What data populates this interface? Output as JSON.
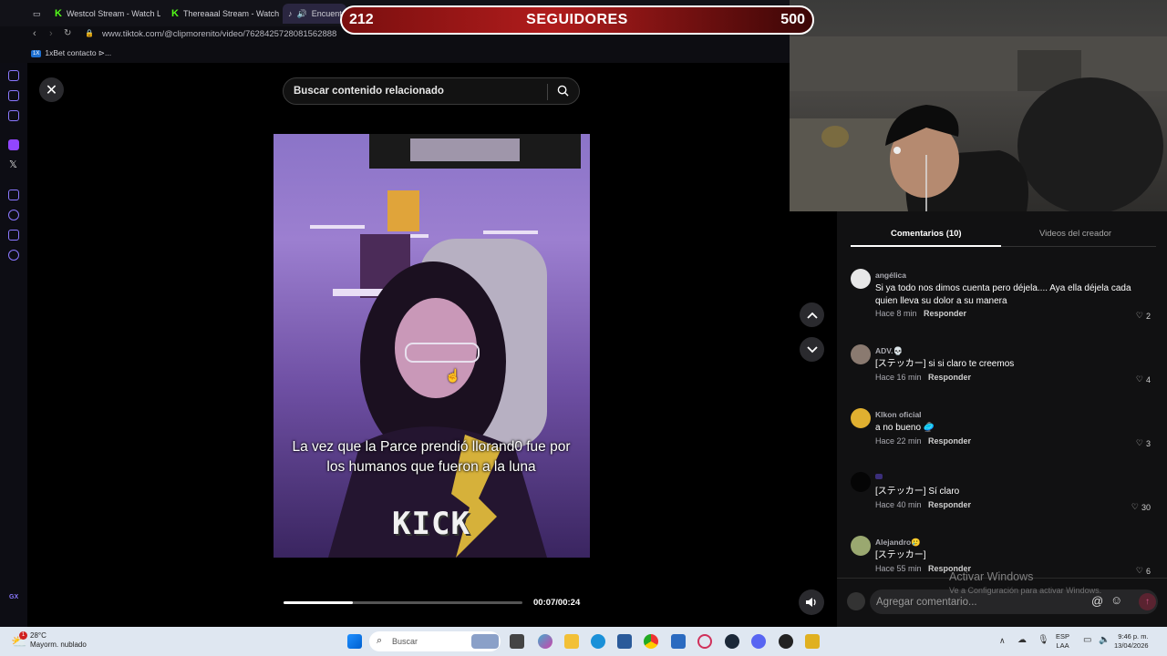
{
  "browser": {
    "tabs": [
      {
        "label": "Westcol Stream - Watch L"
      },
      {
        "label": "Thereaaal Stream - Watch"
      },
      {
        "label": "Encuent"
      }
    ],
    "url": "www.tiktok.com/@clipmorenito/video/7628425728081562888",
    "bookmark": "1xBet contacto ⊳..."
  },
  "overlay": {
    "count_left": "212",
    "label": "SEGUIDORES",
    "count_right": "500"
  },
  "tiktok": {
    "search_placeholder": "Buscar contenido relacionado",
    "caption": "La vez que la Parce prendió llorand0 fue por los humanos que fueron a la luna",
    "brand": "KICK",
    "time": "00:07/00:24",
    "progress": 0.29,
    "tabs": {
      "comments": "Comentarios (10)",
      "videos": "Videos del creador"
    },
    "comments": [
      {
        "user": "angélica",
        "text": "Si ya todo nos dimos cuenta pero déjela.... Aya ella déjela cada quien lleva su dolor a su manera",
        "time": "Hace 8 min",
        "reply": "Responder",
        "likes": "2"
      },
      {
        "user": "ADV.💀",
        "text": "[ステッカー] si si claro te creemos",
        "time": "Hace 16 min",
        "reply": "Responder",
        "likes": "4"
      },
      {
        "user": "Klkon oficial",
        "text": "a no bueno 🥏",
        "time": "Hace 22 min",
        "reply": "Responder",
        "likes": "3"
      },
      {
        "user": "",
        "text": "[ステッカー] Sí claro",
        "time": "Hace 40 min",
        "reply": "Responder",
        "likes": "30"
      },
      {
        "user": "Alejandro🥲",
        "text": "[ステッカー]",
        "time": "Hace 55 min",
        "reply": "Responder",
        "likes": "6"
      }
    ],
    "add_comment_placeholder": "Agregar comentario..."
  },
  "windows": {
    "watermark_title": "Activar Windows",
    "watermark_sub": "Ve a Configuración para activar Windows.",
    "weather_temp": "28°C",
    "weather_desc": "Mayorm. nublado",
    "search": "Buscar",
    "lang_1": "ESP",
    "lang_2": "LAA",
    "clock_time": "9:46 p. m.",
    "clock_date": "13/04/2026"
  }
}
